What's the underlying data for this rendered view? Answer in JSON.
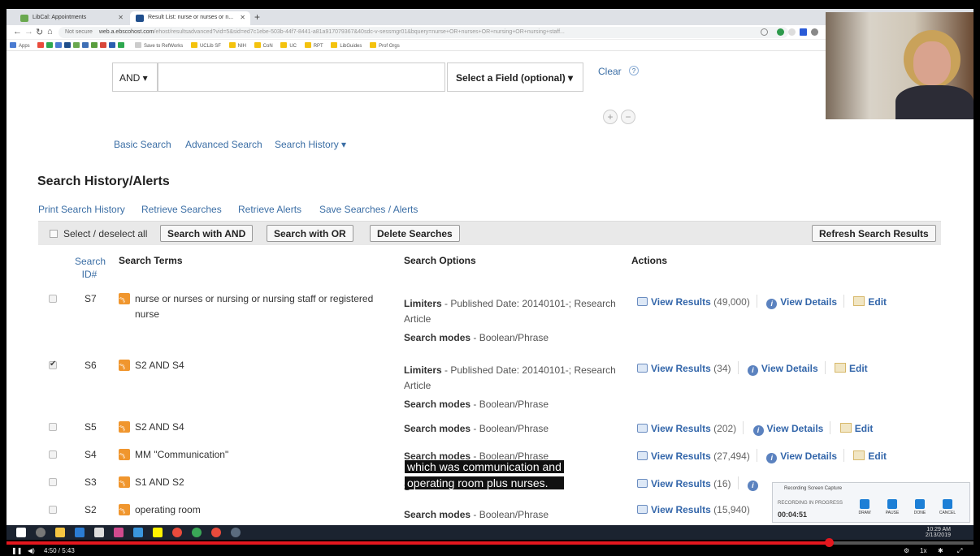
{
  "browser": {
    "tabs": [
      {
        "title": "LibCal: Appointments",
        "active": false
      },
      {
        "title": "Result List: nurse or nurses or n...",
        "active": true
      }
    ],
    "url_host": "web.a.ebscohost.com",
    "url_path": "/ehost/resultsadvanced?vid=5&sid=ed7c1ebe-503b-44f7-8441-a81a917079367&40sdc-v-sessmgr01&bquery=nurse+OR+nurses+OR+nursing+OR+nursing+staff...",
    "security_label": "Not secure",
    "bookmarks": [
      "Apps",
      "Save to RefWorks",
      "UCLib SF",
      "NIH",
      "CoN",
      "UC",
      "RPT",
      "LibGuides",
      "Prof Orgs"
    ]
  },
  "search_form": {
    "bool_op": "AND ▾",
    "field_select": "Select a Field (optional) ▾",
    "clear": "Clear",
    "help": "?",
    "add": "+",
    "remove": "−"
  },
  "search_nav": {
    "basic": "Basic Search",
    "advanced": "Advanced Search",
    "history": "Search History ▾"
  },
  "history": {
    "title": "Search History/Alerts",
    "links": [
      "Print Search History",
      "Retrieve Searches",
      "Retrieve Alerts",
      "Save Searches / Alerts"
    ],
    "select_all": "Select / deselect all",
    "buttons": {
      "with_and": "Search with AND",
      "with_or": "Search with OR",
      "delete": "Delete Searches",
      "refresh": "Refresh Search Results"
    },
    "headers": {
      "id": "Search ID#",
      "terms": "Search Terms",
      "options": "Search Options",
      "actions": "Actions"
    },
    "actions": {
      "view_results": "View Results",
      "view_details": "View Details",
      "edit": "Edit"
    },
    "rows": [
      {
        "id": "S7",
        "checked": false,
        "term": "nurse or nurses or nursing or nursing staff or registered nurse",
        "limiters_label": "Limiters",
        "limiters": " - Published Date: 20140101-; Research Article",
        "modes_label": "Search modes",
        "modes": " - Boolean/Phrase",
        "count": "(49,000)"
      },
      {
        "id": "S6",
        "checked": true,
        "term": "S2 AND S4",
        "limiters_label": "Limiters",
        "limiters": " - Published Date: 20140101-; Research Article",
        "modes_label": "Search modes",
        "modes": " - Boolean/Phrase",
        "count": "(34)"
      },
      {
        "id": "S5",
        "checked": false,
        "term": "S2 AND S4",
        "modes_label": "Search modes",
        "modes": " - Boolean/Phrase",
        "count": "(202)"
      },
      {
        "id": "S4",
        "checked": false,
        "term": "MM \"Communication\"",
        "modes_label": "Search modes",
        "modes": " - Boolean/Phrase",
        "count": "(27,494)"
      },
      {
        "id": "S3",
        "checked": false,
        "term": "S1 AND S2",
        "modes_label": "S",
        "modes": "",
        "count": "(16)"
      },
      {
        "id": "S2",
        "checked": false,
        "term": "operating room",
        "modes_label": "Search modes",
        "modes": " - Boolean/Phrase",
        "count": "(15,940)"
      }
    ]
  },
  "caption": {
    "line1": "which was communication and",
    "line2": "operating room plus nurses."
  },
  "recorder": {
    "title": "Recording Screen Capture",
    "status": "RECORDING IN PROGRESS",
    "time": "00:04:51",
    "buttons": [
      "DRAW",
      "PAUSE",
      "DONE",
      "CANCEL"
    ]
  },
  "taskbar": {
    "clock_time": "10:29 AM",
    "clock_date": "2/13/2019"
  },
  "player": {
    "time": "4:50 / 5:43",
    "speed": "1x",
    "progress": 0.85
  }
}
